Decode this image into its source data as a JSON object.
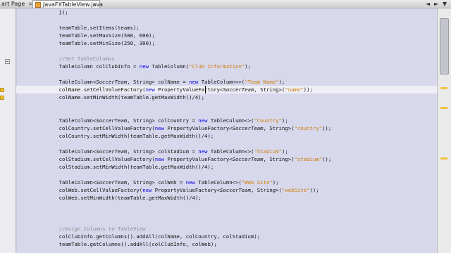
{
  "tabs": {
    "inactive_label": "art Page",
    "active_label": "JavaFXTableView.java",
    "close_glyph": "×"
  },
  "tab_nav": {
    "left": "◄",
    "right": "►",
    "menu": "▼"
  },
  "editor": {
    "lines": [
      "    });",
      "",
      "    teamTable.setItems(teams);",
      "    teamTable.setMaxSize(500, 600);",
      "    teamTable.setMinSize(250, 300);",
      "",
      "    //Set TableColumns",
      "    TableColumn colClubInfo = new TableColumn(\"Club Information\");",
      "",
      "    TableColumn<SoccerTeam, String> colName = new TableColumn<>(\"Team Name\");",
      "    colName.setCellValueFactory(new PropertyValueFactory<SoccerTeam, String>(\"name\"));",
      "    colName.setMinWidth(teamTable.getMaxWidth()/4);",
      "",
      "",
      "    TableColumn<SoccerTeam, String> colCountry = new TableColumn<>(\"Country\");",
      "    colCountry.setCellValueFactory(new PropertyValueFactory<SoccerTeam, String>(\"country\"));",
      "    colCountry.setMinWidth(teamTable.getMaxWidth()/4);",
      "",
      "    TableColumn<SoccerTeam, String> colStadium = new TableColumn<>(\"Stadium\");",
      "    colStadium.setCellValueFactory(new PropertyValueFactory<SoccerTeam, String>(\"stadium\"));",
      "    colStadium.setMinWidth(teamTable.getMaxWidth()/4);",
      "",
      "    TableColumn<SoccerTeam, String> colWeb = new TableColumn<>(\"Web Site\");",
      "    colWeb.setCellValueFactory(new PropertyValueFactory<SoccerTeam, String>(\"webSite\"));",
      "    colWeb.setMinWidth(teamTable.getMaxWidth()/4);",
      "",
      "",
      "",
      "    //Asign Columns to TableView",
      "    colClubInfo.getColumns().addAll(colName, colCountry, colStadium);",
      "    teamTable.getColumns().addAll(colClubInfo, colWeb);"
    ],
    "highlighted_line": 10,
    "warning_lines": [
      9,
      10
    ],
    "colors": {
      "keyword": "#0000e6",
      "string": "#ce7b00",
      "comment": "#8a8a8a",
      "background": "#d8d8ec",
      "current_line": "#eeeef4"
    }
  }
}
